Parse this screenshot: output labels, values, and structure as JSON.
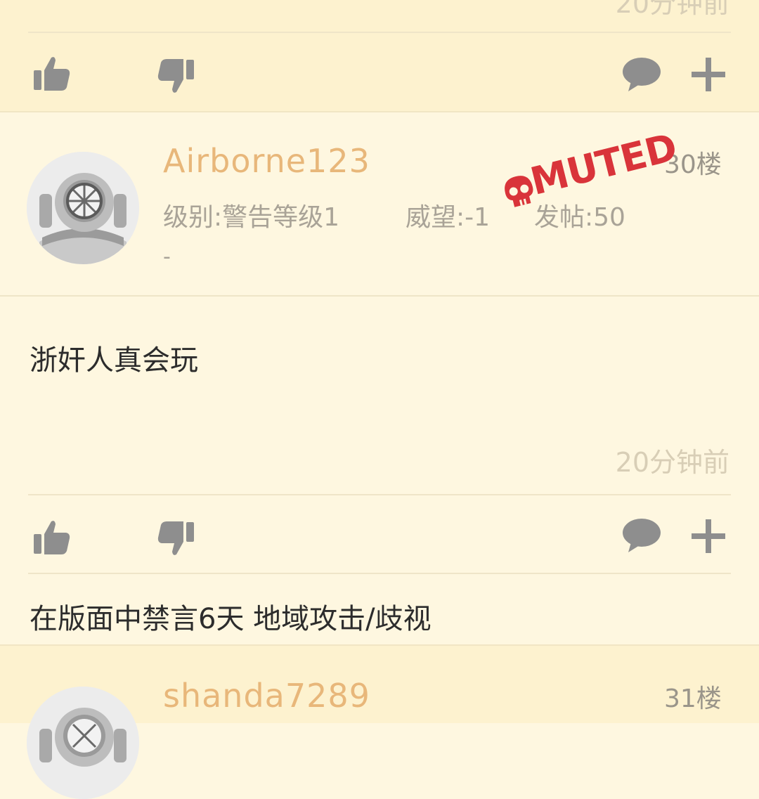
{
  "previous_post": {
    "time": "20分钟前"
  },
  "post": {
    "username": "Airborne123",
    "floor": "30楼",
    "meta": {
      "level": "级别:警告等级1",
      "prestige": "威望:-1",
      "posts": "发帖:50"
    },
    "signature": "-",
    "muted_badge": "MUTED",
    "content": "浙奸人真会玩",
    "time": "20分钟前",
    "moderation_note": "在版面中禁言6天 地域攻击/歧视"
  },
  "next_post": {
    "username": "shanda7289",
    "floor": "31楼"
  },
  "colors": {
    "username": "#e8b77a",
    "muted": "#d9343a",
    "icon": "#8e8e8e",
    "background": "#fef7e0",
    "band": "#fdf2cf"
  },
  "icons": [
    "thumbs-up-icon",
    "thumbs-down-icon",
    "comment-icon",
    "plus-icon",
    "skull-icon",
    "diver-helmet-avatar"
  ]
}
